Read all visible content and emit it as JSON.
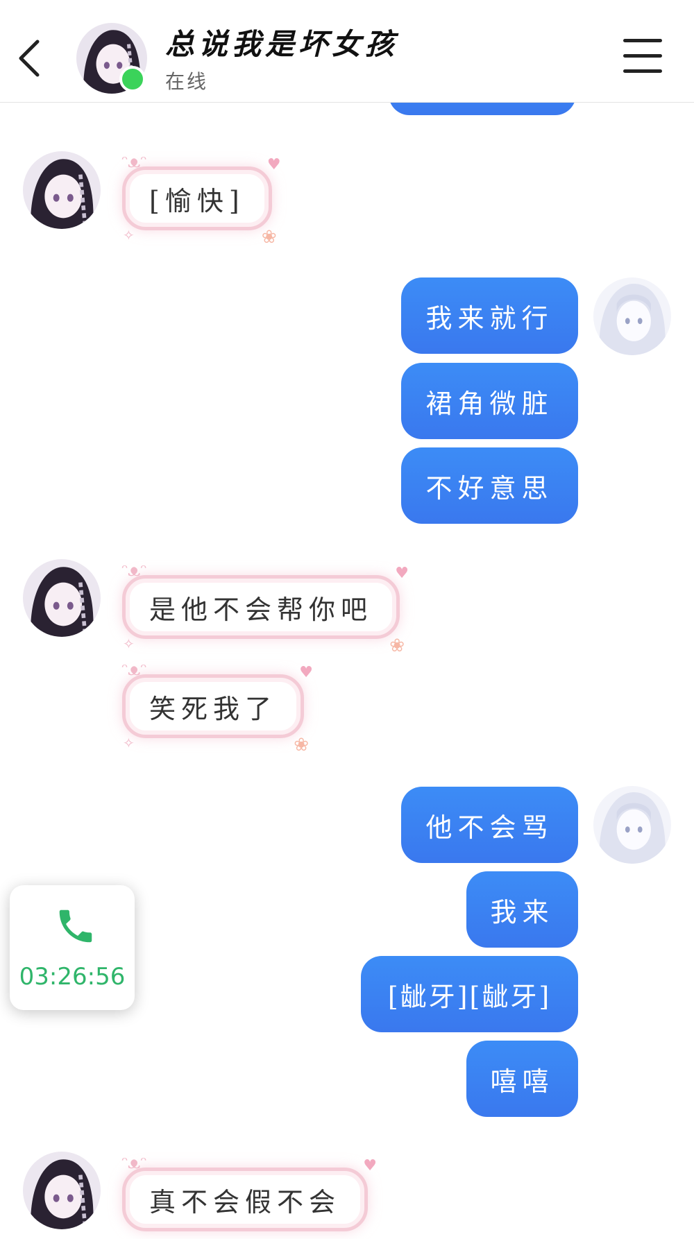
{
  "header": {
    "title": "总说我是坏女孩",
    "status": "在线",
    "status_color": "#3bd35a"
  },
  "messages": [
    {
      "from": "me",
      "text": ""
    },
    {
      "from": "her",
      "text": "[愉快]"
    },
    {
      "from": "me",
      "text": "我来就行"
    },
    {
      "from": "me",
      "text": "裙角微脏"
    },
    {
      "from": "me",
      "text": "不好意思"
    },
    {
      "from": "her",
      "text": "是他不会帮你吧"
    },
    {
      "from": "her",
      "text": "笑死我了"
    },
    {
      "from": "me",
      "text": "他不会骂"
    },
    {
      "from": "me",
      "text": "我来"
    },
    {
      "from": "me",
      "text": "[龇牙][龇牙]"
    },
    {
      "from": "me",
      "text": "嘻嘻"
    },
    {
      "from": "her",
      "text": "真不会假不会"
    }
  ],
  "call": {
    "timer": "03:26:56",
    "icon": "phone-icon",
    "color": "#2fb56a"
  },
  "colors": {
    "my_bubble": "#3a82f2",
    "her_bubble_border": "#f4cbd6"
  }
}
